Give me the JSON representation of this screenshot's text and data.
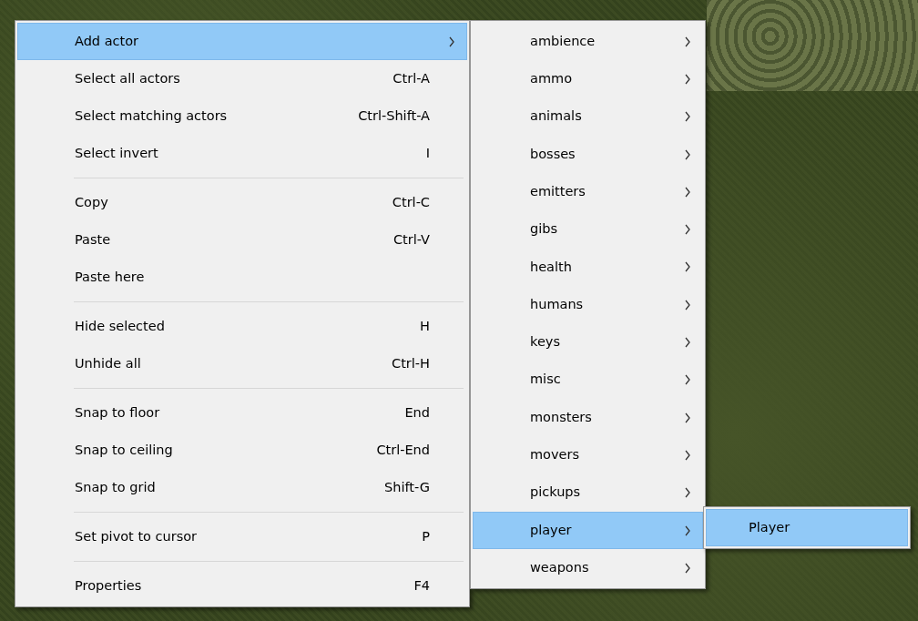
{
  "main_menu": {
    "groups": [
      {
        "items": [
          {
            "label": "Add actor",
            "has_submenu": true,
            "selected": true
          },
          {
            "label": "Select all actors",
            "shortcut": "Ctrl-A",
            "has_submenu": false,
            "selected": false
          },
          {
            "label": "Select matching actors",
            "shortcut": "Ctrl-Shift-A",
            "has_submenu": false,
            "selected": false
          },
          {
            "label": "Select invert",
            "shortcut": "I",
            "has_submenu": false,
            "selected": false
          }
        ]
      },
      {
        "items": [
          {
            "label": "Copy",
            "shortcut": "Ctrl-C",
            "has_submenu": false,
            "selected": false
          },
          {
            "label": "Paste",
            "shortcut": "Ctrl-V",
            "has_submenu": false,
            "selected": false
          },
          {
            "label": "Paste here",
            "has_submenu": false,
            "selected": false
          }
        ]
      },
      {
        "items": [
          {
            "label": "Hide selected",
            "shortcut": "H",
            "has_submenu": false,
            "selected": false
          },
          {
            "label": "Unhide all",
            "shortcut": "Ctrl-H",
            "has_submenu": false,
            "selected": false
          }
        ]
      },
      {
        "items": [
          {
            "label": "Snap to floor",
            "shortcut": "End",
            "has_submenu": false,
            "selected": false
          },
          {
            "label": "Snap to ceiling",
            "shortcut": "Ctrl-End",
            "has_submenu": false,
            "selected": false
          },
          {
            "label": "Snap to grid",
            "shortcut": "Shift-G",
            "has_submenu": false,
            "selected": false
          }
        ]
      },
      {
        "items": [
          {
            "label": "Set pivot to cursor",
            "shortcut": "P",
            "has_submenu": false,
            "selected": false
          }
        ]
      },
      {
        "items": [
          {
            "label": "Properties",
            "shortcut": "F4",
            "has_submenu": false,
            "selected": false
          }
        ]
      }
    ]
  },
  "actor_submenu": {
    "items": [
      {
        "label": "ambience",
        "has_submenu": true,
        "selected": false
      },
      {
        "label": "ammo",
        "has_submenu": true,
        "selected": false
      },
      {
        "label": "animals",
        "has_submenu": true,
        "selected": false
      },
      {
        "label": "bosses",
        "has_submenu": true,
        "selected": false
      },
      {
        "label": "emitters",
        "has_submenu": true,
        "selected": false
      },
      {
        "label": "gibs",
        "has_submenu": true,
        "selected": false
      },
      {
        "label": "health",
        "has_submenu": true,
        "selected": false
      },
      {
        "label": "humans",
        "has_submenu": true,
        "selected": false
      },
      {
        "label": "keys",
        "has_submenu": true,
        "selected": false
      },
      {
        "label": "misc",
        "has_submenu": true,
        "selected": false
      },
      {
        "label": "monsters",
        "has_submenu": true,
        "selected": false
      },
      {
        "label": "movers",
        "has_submenu": true,
        "selected": false
      },
      {
        "label": "pickups",
        "has_submenu": true,
        "selected": false
      },
      {
        "label": "player",
        "has_submenu": true,
        "selected": true
      },
      {
        "label": "weapons",
        "has_submenu": true,
        "selected": false
      }
    ]
  },
  "player_submenu": {
    "items": [
      {
        "label": "Player",
        "has_submenu": false,
        "selected": true
      }
    ]
  }
}
